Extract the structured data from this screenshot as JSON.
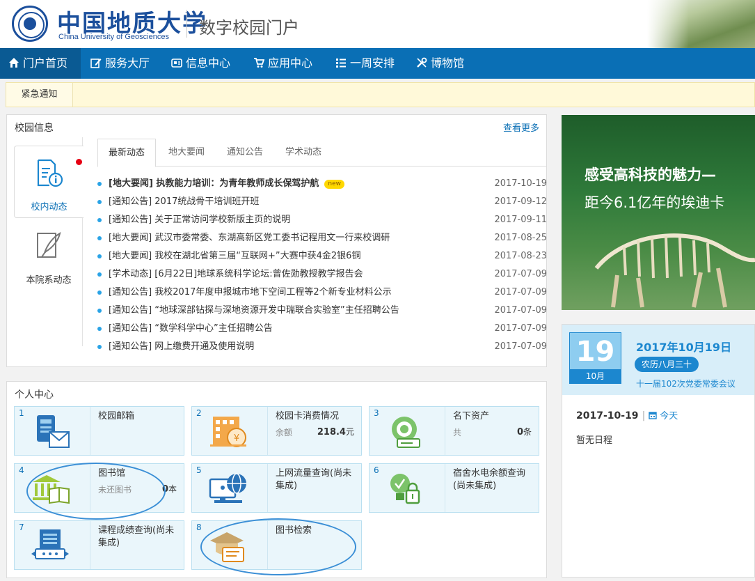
{
  "header": {
    "logo_cn": "中国地质大学",
    "logo_en": "China University of Geosciences",
    "site_title": "数字校园门户"
  },
  "nav": {
    "items": [
      {
        "label": "门户首页",
        "icon": "home-icon"
      },
      {
        "label": "服务大厅",
        "icon": "edit-icon"
      },
      {
        "label": "信息中心",
        "icon": "feed-icon"
      },
      {
        "label": "应用中心",
        "icon": "cart-icon"
      },
      {
        "label": "一周安排",
        "icon": "list-icon"
      },
      {
        "label": "博物馆",
        "icon": "tools-icon"
      }
    ]
  },
  "notice": {
    "label": "紧急通知"
  },
  "campus_info": {
    "title": "校园信息",
    "more": "查看更多",
    "side_tabs": [
      {
        "label": "校内动态",
        "icon": "document-info-icon"
      },
      {
        "label": "本院系动态",
        "icon": "quill-icon"
      }
    ],
    "tabs": [
      "最新动态",
      "地大要闻",
      "通知公告",
      "学术动态"
    ],
    "news": [
      {
        "text": "[地大要闻] 执教能力培训：为青年教师成长保驾护航",
        "date": "2017-10-19",
        "badge": "new"
      },
      {
        "text": "[通知公告] 2017统战骨干培训班开班",
        "date": "2017-09-12"
      },
      {
        "text": "[通知公告] 关于正常访问学校新版主页的说明",
        "date": "2017-09-11"
      },
      {
        "text": "[地大要闻] 武汉市委常委、东湖高新区党工委书记程用文一行来校调研",
        "date": "2017-08-25"
      },
      {
        "text": "[地大要闻] 我校在湖北省第三届“互联网+”大赛中获4金2银6铜",
        "date": "2017-08-23"
      },
      {
        "text": "[学术动态] [6月22日]地球系统科学论坛:曾佐勋教授教学报告会",
        "date": "2017-07-09"
      },
      {
        "text": "[通知公告] 我校2017年度申报城市地下空间工程等2个新专业材料公示",
        "date": "2017-07-09"
      },
      {
        "text": "[通知公告] “地球深部钻探与深地资源开发中瑞联合实验室”主任招聘公告",
        "date": "2017-07-09"
      },
      {
        "text": "[通知公告] “数学科学中心”主任招聘公告",
        "date": "2017-07-09"
      },
      {
        "text": "[通知公告] 网上缴费开通及使用说明",
        "date": "2017-07-09"
      }
    ]
  },
  "personal_center": {
    "title": "个人中心",
    "cards": [
      {
        "num": "1",
        "title": "校园邮箱",
        "icon": "mail-icon"
      },
      {
        "num": "2",
        "title": "校园卡消费情况",
        "sub": "余额",
        "value": "218.4",
        "unit": "元",
        "icon": "campus-card-icon"
      },
      {
        "num": "3",
        "title": "名下资产",
        "sub": "共",
        "value": "0",
        "unit": "条",
        "icon": "assets-icon"
      },
      {
        "num": "4",
        "title": "图书馆",
        "sub": "未还图书",
        "value": "0",
        "unit": "本",
        "icon": "library-icon"
      },
      {
        "num": "5",
        "title": "上网流量查询(尚未集成)",
        "icon": "network-icon"
      },
      {
        "num": "6",
        "title": "宿舍水电余额查询(尚未集成)",
        "icon": "utility-icon"
      },
      {
        "num": "7",
        "title": "课程成绩查询(尚未集成)",
        "icon": "grades-icon"
      },
      {
        "num": "8",
        "title": "图书检索",
        "icon": "book-search-icon"
      }
    ]
  },
  "banner": {
    "line1": "感受高科技的魅力—",
    "line2": "距今6.1亿年的埃迪卡"
  },
  "calendar": {
    "day": "19",
    "month": "10月",
    "full_date": "2017年10月19日",
    "lunar": "农历八月三十",
    "meeting": "十一届102次党委常委会议",
    "schedule_date": "2017-10-19",
    "separator": "|",
    "today": "今天",
    "no_schedule": "暂无日程"
  },
  "colors": {
    "nav_bg": "#0a6fb5",
    "nav_active": "#0a5a93",
    "accent": "#1c87cf",
    "card_bg": "#eaf6fb",
    "notice_bg": "#fff9d9",
    "annotation": "#3b8fd6"
  }
}
